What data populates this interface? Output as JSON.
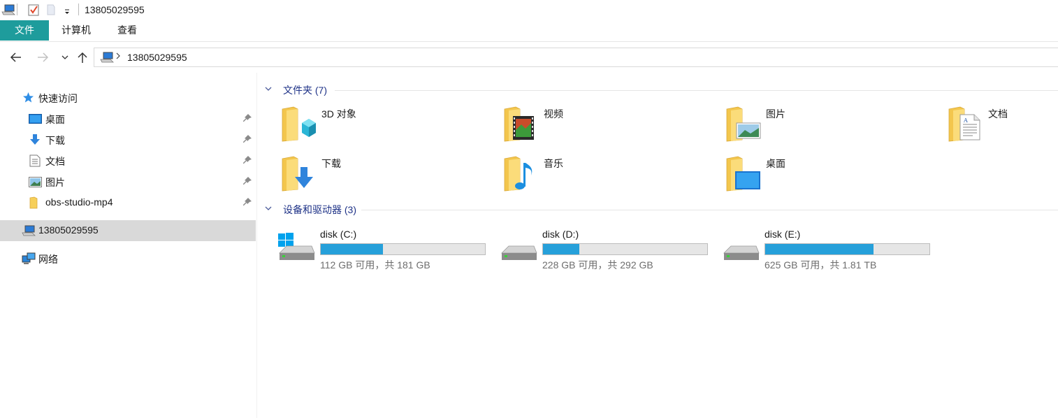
{
  "titlebar": {
    "title": "13805029595"
  },
  "ribbon": {
    "tabs": [
      "文件",
      "计算机",
      "查看"
    ]
  },
  "address": {
    "path": "13805029595"
  },
  "nav": {
    "quick_access": "快速访问",
    "items": [
      "桌面",
      "下载",
      "文档",
      "图片",
      "obs-studio-mp4"
    ],
    "this_pc": "13805029595",
    "network": "网络"
  },
  "groups": {
    "folders": "文件夹 (7)",
    "devices": "设备和驱动器 (3)"
  },
  "folders": [
    "3D 对象",
    "视频",
    "图片",
    "文档",
    "下载",
    "音乐",
    "桌面"
  ],
  "drives": [
    {
      "name": "disk (C:)",
      "free": "112 GB 可用，共 181 GB",
      "used_fraction": 0.38
    },
    {
      "name": "disk (D:)",
      "free": "228 GB 可用，共 292 GB",
      "used_fraction": 0.22
    },
    {
      "name": "disk (E:)",
      "free": "625 GB 可用，共 1.81 TB",
      "used_fraction": 0.66
    }
  ],
  "colors": {
    "accent": "#1e9c9c",
    "drive_bar": "#26a0da",
    "group_title": "#1e3287",
    "selected": "#d9d9d9"
  }
}
